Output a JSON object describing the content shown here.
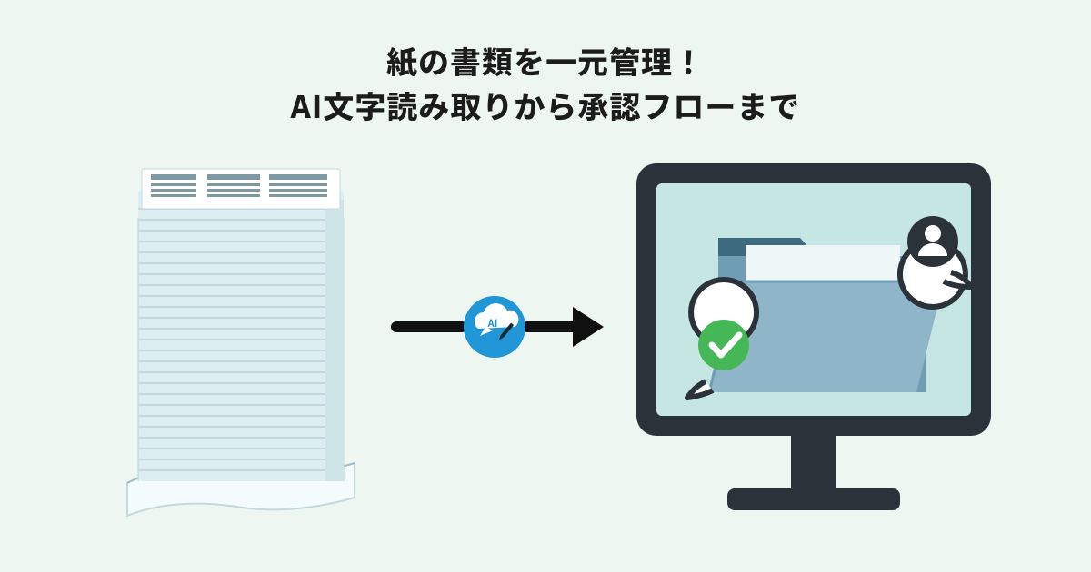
{
  "heading": {
    "line1": "紙の書類を一元管理！",
    "line2": "AI文字読み取りから承認フローまで"
  },
  "ai_badge_label": "AI",
  "icons": {
    "paper_stack": "paper-stack-icon",
    "ai_cloud": "ai-cloud-icon",
    "arrow": "arrow-right-icon",
    "monitor": "monitor-icon",
    "folder": "folder-icon",
    "check": "check-circle-icon",
    "user": "user-circle-icon"
  },
  "colors": {
    "bg": "#eef6f1",
    "text": "#1c1c1c",
    "ai_blue": "#2096d6",
    "monitor_frame": "#2b323a",
    "monitor_screen": "#c6e6e3",
    "folder_main": "#6f9db4",
    "folder_front": "#8fb6c8",
    "check_green": "#45b757",
    "user_dark": "#2b323a",
    "paper_light": "#eef7f8",
    "paper_shadow": "#c4d8dd"
  }
}
